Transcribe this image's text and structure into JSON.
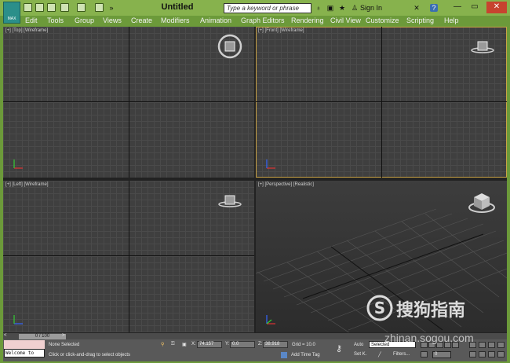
{
  "app": {
    "logo_text": "MAX",
    "title": "Untitled",
    "search_placeholder": "Type a keyword or phrase",
    "sign_in": "Sign In",
    "help": "?"
  },
  "menu": [
    "Edit",
    "Tools",
    "Group",
    "Views",
    "Create",
    "Modifiers",
    "Animation",
    "Graph Editors",
    "Rendering",
    "Civil View",
    "Customize",
    "Scripting",
    "Help"
  ],
  "viewports": {
    "top": "[+] [Top] [Wireframe]",
    "front": "[+] [Front] [Wireframe]",
    "left": "[+] [Left] [Wireframe]",
    "perspective": "[+] [Perspective] [Realistic]"
  },
  "timeline": {
    "slider": "0 / 100"
  },
  "status": {
    "welcome_top": "",
    "welcome_bottom": "Welcome to",
    "selection": "None Selected",
    "prompt": "Click or click-and-drag to select objects",
    "x_label": "X:",
    "x_value": "74.157",
    "y_label": "Y:",
    "y_value": "0.0",
    "z_label": "Z:",
    "z_value": "38.918",
    "grid": "Grid = 10.0",
    "add_time_tag": "Add Time Tag",
    "auto": "Auto",
    "set_k": "Set K.",
    "selected": "Selected",
    "filters": "Filters...",
    "frame": "0"
  },
  "watermark": {
    "logo_char": "S",
    "text": "搜狗指南",
    "url": "zhinan.sogou.com"
  },
  "colors": {
    "titlebar": "#87b24d",
    "menubar": "#6c9a3a",
    "viewport_bg": "#3f3f3f",
    "active_border": "#c9a245",
    "close_button": "#c7432f"
  }
}
